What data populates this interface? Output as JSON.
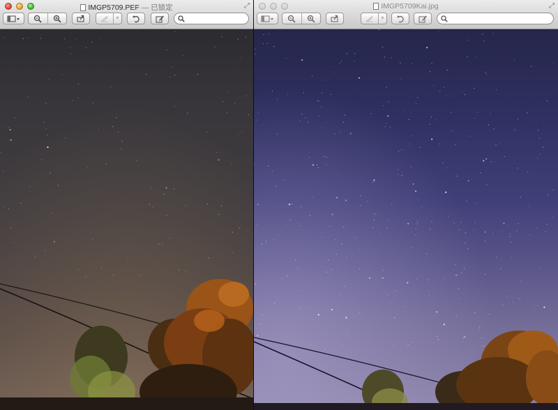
{
  "left_window": {
    "title": "IMGP5709.PEF",
    "title_suffix": "— 已锁定",
    "search": {
      "value": "",
      "placeholder": ""
    }
  },
  "right_window": {
    "title": "IMGP5709Kai.jpg",
    "search": {
      "value": "",
      "placeholder": ""
    }
  },
  "toolbar": {
    "view_icon": "sidebar-view-icon",
    "zoom_out_icon": "zoom-out-icon",
    "zoom_in_icon": "zoom-in-icon",
    "share_icon": "share-icon",
    "markup_icon": "pen-icon",
    "rotate_icon": "rotate-icon",
    "edit_icon": "edit-icon",
    "search_icon": "search-icon"
  },
  "colors": {
    "left_sky": "#3a373c",
    "right_sky": "#3a3a70",
    "tree_orange": "#b5621a",
    "tree_green": "#6f8a3a"
  }
}
